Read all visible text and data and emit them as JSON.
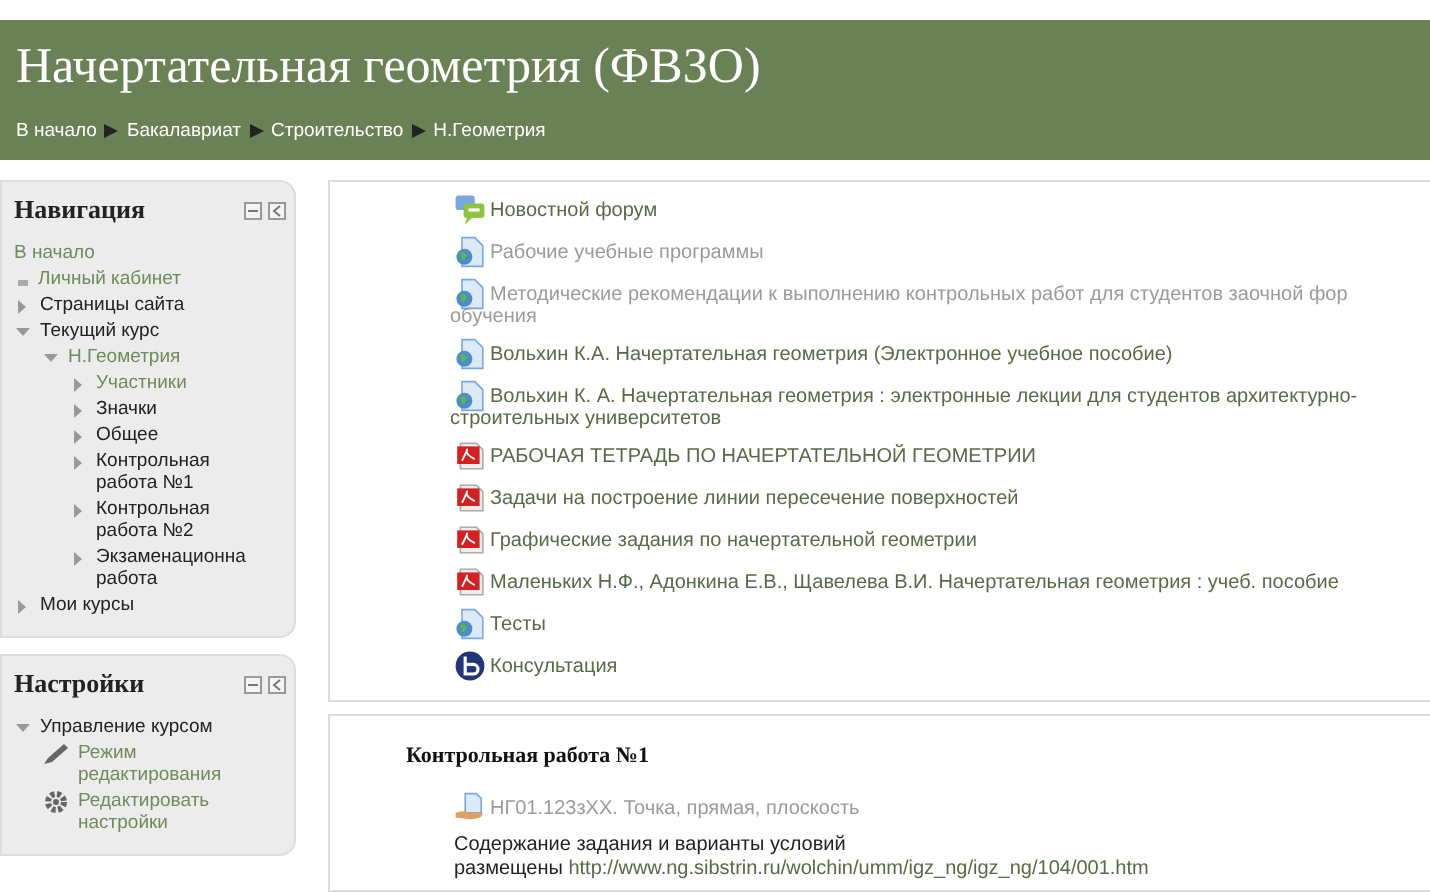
{
  "header": {
    "title": "Начертательная геометрия (ФВЗО)",
    "breadcrumbs": [
      "В начало",
      "Бакалавриат",
      "Строительство",
      "Н.Геометрия"
    ]
  },
  "navigation": {
    "title": "Навигация",
    "items": [
      {
        "label": "В начало",
        "kind": "plain",
        "dimmed": true
      },
      {
        "label": "Личный кабинет",
        "kind": "leaf",
        "dimmed": true
      },
      {
        "label": "Страницы сайта",
        "kind": "branch",
        "expanded": false,
        "dimmed": false
      },
      {
        "label": "Текущий курс",
        "kind": "branch",
        "expanded": true,
        "dimmed": false,
        "children": [
          {
            "label": "Н.Геометрия",
            "kind": "branch",
            "expanded": true,
            "dimmed": true,
            "children": [
              {
                "label": "Участники",
                "kind": "branch",
                "expanded": false,
                "dimmed": true
              },
              {
                "label": "Значки",
                "kind": "branch",
                "expanded": false,
                "dimmed": false
              },
              {
                "label": "Общее",
                "kind": "branch",
                "expanded": false,
                "dimmed": false
              },
              {
                "label": "Контрольная работа №1",
                "kind": "branch",
                "expanded": false,
                "dimmed": false
              },
              {
                "label": "Контрольная работа №2",
                "kind": "branch",
                "expanded": false,
                "dimmed": false
              },
              {
                "label": "Экзаменационна работа",
                "kind": "branch",
                "expanded": false,
                "dimmed": false
              }
            ]
          }
        ]
      },
      {
        "label": "Мои курсы",
        "kind": "branch",
        "expanded": false,
        "dimmed": false
      }
    ]
  },
  "settings": {
    "title": "Настройки",
    "items": [
      {
        "label": "Управление курсом",
        "kind": "branch",
        "expanded": true,
        "dimmed": false,
        "children": [
          {
            "label": "Режим редактирования",
            "kind": "pencil",
            "dimmed": true
          },
          {
            "label": "Редактировать настройки",
            "kind": "gear",
            "dimmed": true
          }
        ]
      }
    ]
  },
  "sections": [
    {
      "items": [
        {
          "kind": "forum",
          "dimmed": false,
          "lines": [
            "Новостной форум"
          ]
        },
        {
          "kind": "page",
          "dimmed": true,
          "lines": [
            "Рабочие учебные программы"
          ]
        },
        {
          "kind": "page",
          "dimmed": true,
          "lines": [
            "Методические рекомендации к выполнению контрольных работ для студентов заочной фор",
            "обучения"
          ]
        },
        {
          "kind": "page",
          "dimmed": false,
          "lines": [
            "Вольхин К.А. Начертательная геометрия (Электронное учебное пособие)"
          ]
        },
        {
          "kind": "page",
          "dimmed": false,
          "lines": [
            "Вольхин К. А. Начертательная геометрия : электронные лекции для студентов архитектурно-",
            "строительных университетов"
          ]
        },
        {
          "kind": "pdf",
          "dimmed": false,
          "lines": [
            "РАБОЧАЯ ТЕТРАДЬ ПО НАЧЕРТАТЕЛЬНОЙ ГЕОМЕТРИИ"
          ]
        },
        {
          "kind": "pdf",
          "dimmed": false,
          "lines": [
            "Задачи на построение линии пересечение поверхностей"
          ]
        },
        {
          "kind": "pdf",
          "dimmed": false,
          "lines": [
            "Графические задания по начертательной геометрии"
          ]
        },
        {
          "kind": "pdf",
          "dimmed": false,
          "lines": [
            "Маленьких Н.Ф., Адонкина Е.В., Щавелева В.И. Начертательная геометрия : учеб. пособие"
          ]
        },
        {
          "kind": "page",
          "dimmed": false,
          "lines": [
            "Тесты"
          ]
        },
        {
          "kind": "meeting",
          "dimmed": false,
          "lines": [
            "Консультация"
          ]
        }
      ]
    },
    {
      "title": "Контрольная работа №1",
      "items": [
        {
          "kind": "assignment",
          "dimmed": true,
          "lines": [
            "НГ01.123зХХ. Точка, прямая, плоскость"
          ]
        }
      ],
      "note": {
        "lines": [
          "Содержание задания и варианты условий",
          "размещены"
        ],
        "link": "http://www.ng.sibstrin.ru/wolchin/umm/igz_ng/igz_ng/104/001.htm"
      }
    }
  ]
}
